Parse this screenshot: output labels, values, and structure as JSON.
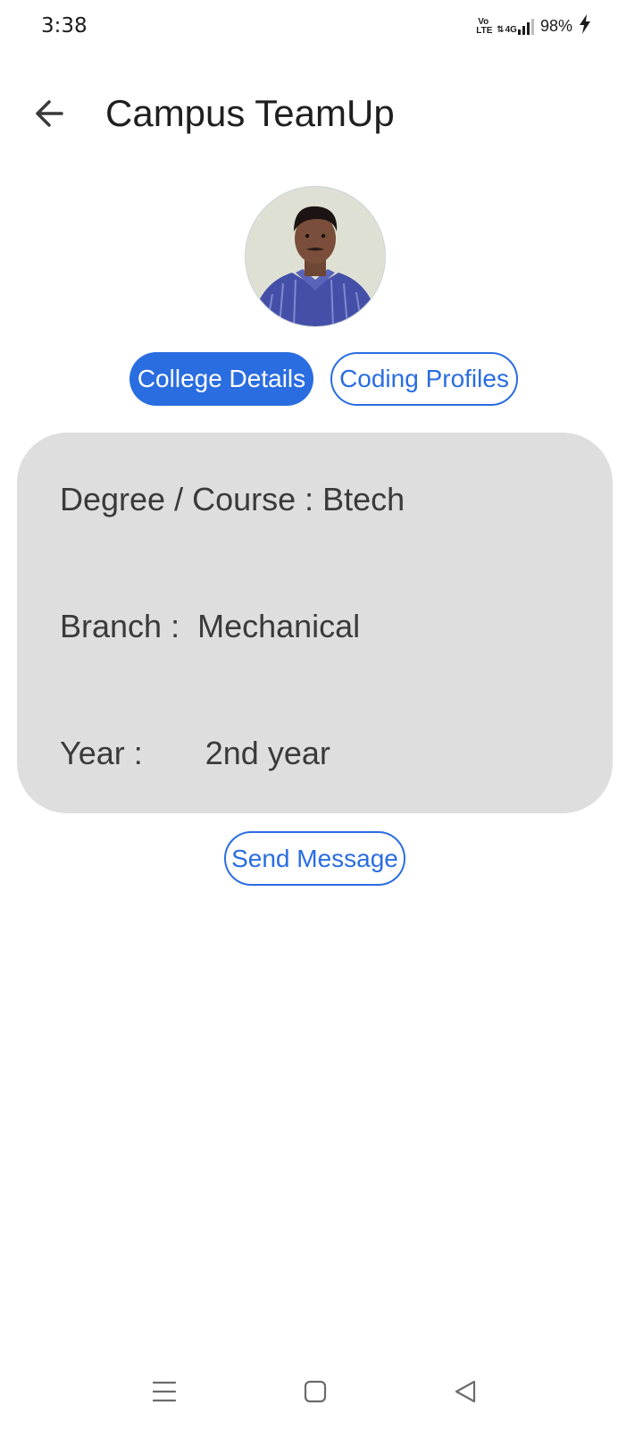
{
  "status_bar": {
    "time": "3:38",
    "volte": "Vo LTE",
    "network": "4G",
    "battery": "98%",
    "icons": [
      "volte-icon",
      "signal-icon",
      "battery-charging-icon"
    ]
  },
  "app_bar": {
    "title": "Campus TeamUp",
    "back_icon": "arrow-left-icon"
  },
  "profile": {
    "avatar_icon": "profile-photo"
  },
  "tabs": [
    {
      "label": "College Details",
      "active": true
    },
    {
      "label": "Coding Profiles",
      "active": false
    }
  ],
  "details": {
    "degree": {
      "label": "Degree / Course : ",
      "value": "Btech"
    },
    "branch": {
      "label": "Branch :  ",
      "value": "Mechanical"
    },
    "year": {
      "label": "Year :       ",
      "value": "2nd year"
    }
  },
  "actions": {
    "send_message": "Send Message"
  },
  "colors": {
    "accent": "#2a6de1",
    "card_bg": "#dedede",
    "text": "#3a3a3a"
  },
  "nav_bar": {
    "icons": [
      "menu-icon",
      "home-icon",
      "back-triangle-icon"
    ]
  }
}
